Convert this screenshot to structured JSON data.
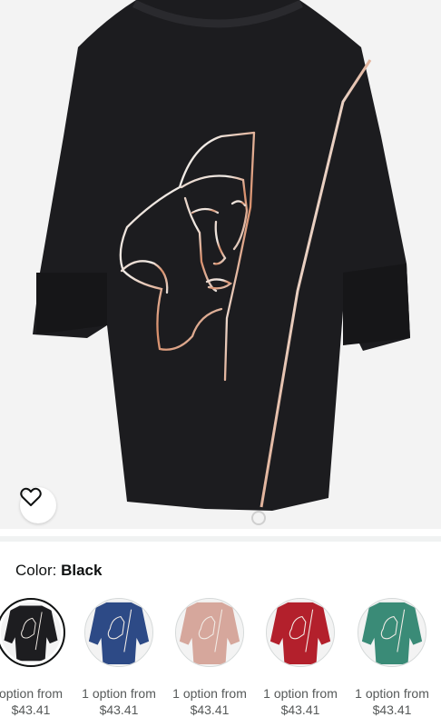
{
  "product_image": {
    "icon": "shirt-icon",
    "color": "#1c1c1f"
  },
  "wishlist": {
    "icon": "heart-icon"
  },
  "color_selector": {
    "label": "Color: ",
    "value": "Black",
    "swatches": [
      {
        "name": "Black",
        "color": "#1d1d20",
        "option_text": "option from",
        "price": "$43.41",
        "selected": true
      },
      {
        "name": "Blue",
        "color": "#2d4a86",
        "option_text": "1 option from",
        "price": "$43.41",
        "selected": false
      },
      {
        "name": "Pink",
        "color": "#d6a79c",
        "option_text": "1 option from",
        "price": "$43.41",
        "selected": false
      },
      {
        "name": "Red",
        "color": "#b3202c",
        "option_text": "1 option from",
        "price": "$43.41",
        "selected": false
      },
      {
        "name": "Green",
        "color": "#3a8b77",
        "option_text": "1 option from",
        "price": "$43.41",
        "selected": false
      }
    ]
  }
}
